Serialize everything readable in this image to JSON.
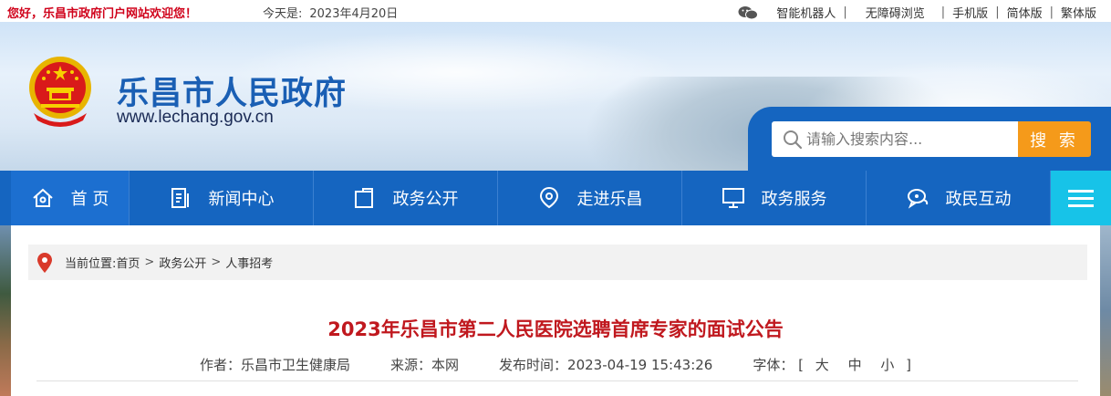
{
  "topbar": {
    "welcome": "您好，乐昌市政府门户网站欢迎您！",
    "today_label": "今天是:",
    "today_date": "2023年4月20日",
    "links": [
      "智能机器人",
      "无障碍浏览",
      "手机版",
      "简体版",
      "繁体版"
    ]
  },
  "header": {
    "site_title": "乐昌市人民政府",
    "site_url": "www.lechang.gov.cn",
    "search_placeholder": "请输入搜索内容...",
    "search_button": "搜 索"
  },
  "nav": {
    "items": [
      {
        "label": "首 页",
        "icon": "home-icon"
      },
      {
        "label": "新闻中心",
        "icon": "news-icon"
      },
      {
        "label": "政务公开",
        "icon": "folder-icon"
      },
      {
        "label": "走进乐昌",
        "icon": "location-icon"
      },
      {
        "label": "政务服务",
        "icon": "monitor-icon"
      },
      {
        "label": "政民互动",
        "icon": "chat-icon"
      }
    ],
    "menu_icon": "hamburger-menu-icon"
  },
  "breadcrumb": {
    "prefix": "当前位置:",
    "items": [
      "首页",
      "政务公开",
      "人事招考"
    ]
  },
  "article": {
    "title": "2023年乐昌市第二人民医院选聘首席专家的面试公告",
    "author_label": "作者：",
    "author": "乐昌市卫生健康局",
    "source_label": "来源：",
    "source": "本网",
    "published_label": "发布时间：",
    "published": "2023-04-19 15:43:26",
    "font_label": "字体：",
    "font_open": "[",
    "font_sizes": [
      "大",
      "中",
      "小"
    ],
    "font_close": "]"
  },
  "colors": {
    "nav_blue": "#1565c0",
    "accent_orange": "#f59a1a",
    "title_red": "#c0181e",
    "menu_cyan": "#17c3e8"
  }
}
